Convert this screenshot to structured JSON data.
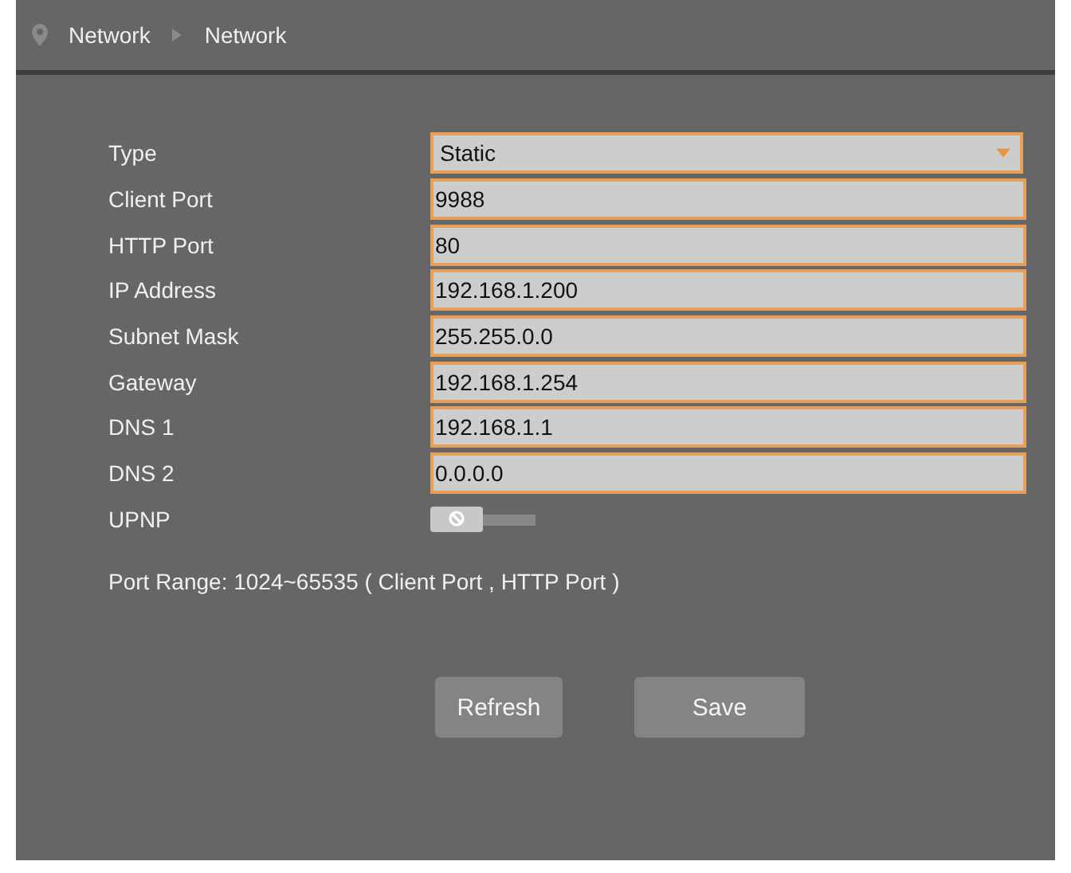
{
  "breadcrumb": [
    "Network",
    "Network"
  ],
  "fields": [
    {
      "kind": "select",
      "label": "Type",
      "value": "Static"
    },
    {
      "kind": "text",
      "label": "Client Port",
      "value": "9988"
    },
    {
      "kind": "text",
      "label": "HTTP Port",
      "value": "80"
    },
    {
      "kind": "text",
      "label": "IP Address",
      "value": "192.168.1.200"
    },
    {
      "kind": "text",
      "label": "Subnet Mask",
      "value": "255.255.0.0"
    },
    {
      "kind": "text",
      "label": "Gateway",
      "value": "192.168.1.254"
    },
    {
      "kind": "text",
      "label": "DNS 1",
      "value": "192.168.1.1"
    },
    {
      "kind": "text",
      "label": "DNS 2",
      "value": "0.0.0.0"
    },
    {
      "kind": "toggle",
      "label": "UPNP",
      "on": false
    }
  ],
  "note": "Port Range: 1024~65535 ( Client Port , HTTP Port )",
  "buttons": [
    "Refresh",
    "Save"
  ]
}
